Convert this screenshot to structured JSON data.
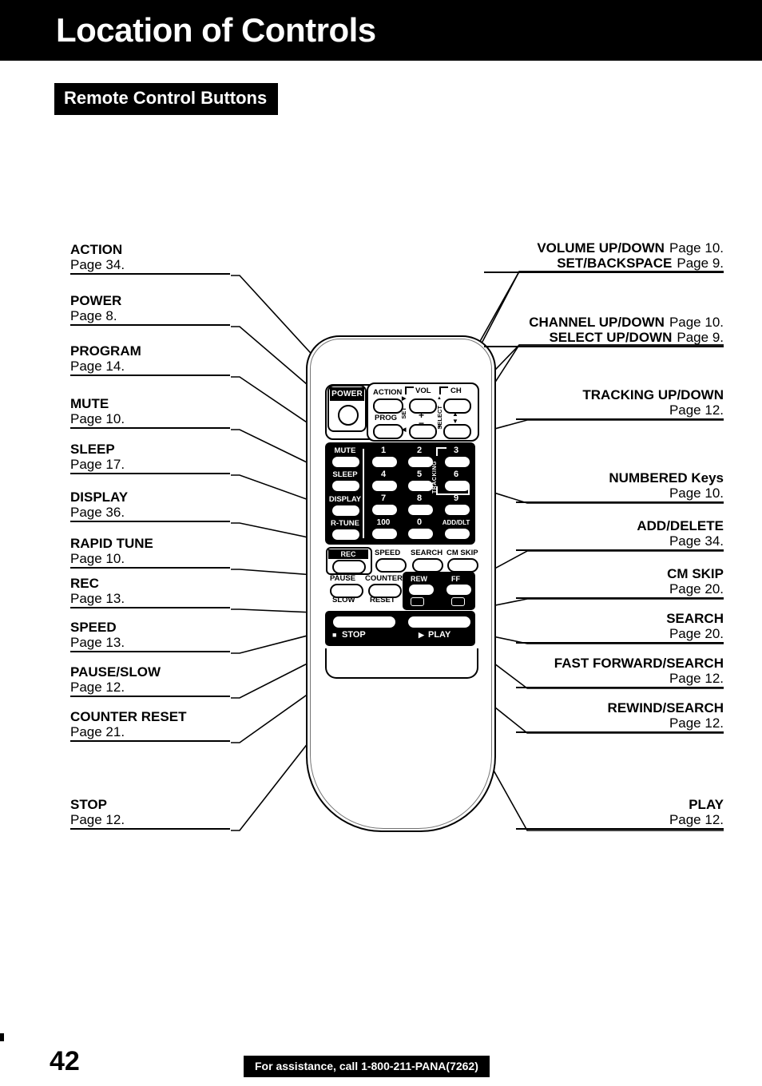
{
  "header": {
    "title": "Location of Controls",
    "section_badge": "Remote Control Buttons"
  },
  "footer": {
    "page_number": "42",
    "assistance": "For assistance, call 1-800-211-PANA(7262)"
  },
  "callouts_left": [
    {
      "title": "ACTION",
      "page": "Page 34."
    },
    {
      "title": "POWER",
      "page": "Page 8."
    },
    {
      "title": "PROGRAM",
      "page": "Page 14."
    },
    {
      "title": "MUTE",
      "page": "Page 10."
    },
    {
      "title": "SLEEP",
      "page": "Page 17."
    },
    {
      "title": "DISPLAY",
      "page": "Page 36."
    },
    {
      "title": "RAPID TUNE",
      "page": "Page 10."
    },
    {
      "title": "REC",
      "page": "Page 13."
    },
    {
      "title": "SPEED",
      "page": "Page 13."
    },
    {
      "title": "PAUSE/SLOW",
      "page": "Page 12."
    },
    {
      "title": "COUNTER RESET",
      "page": "Page 21."
    },
    {
      "title": "STOP",
      "page": "Page 12."
    }
  ],
  "callouts_right": [
    {
      "title": "VOLUME UP/DOWN",
      "page": "Page 10.",
      "inline": true
    },
    {
      "title": "SET/BACKSPACE",
      "page": "Page  9.",
      "inline": true
    },
    {
      "title": "CHANNEL UP/DOWN",
      "page": "Page 10.",
      "inline": true
    },
    {
      "title": "SELECT UP/DOWN",
      "page": "Page  9.",
      "inline": true
    },
    {
      "title": "TRACKING UP/DOWN",
      "page": "Page 12."
    },
    {
      "title": "NUMBERED Keys",
      "page": "Page 10."
    },
    {
      "title": "ADD/DELETE",
      "page": "Page 34."
    },
    {
      "title": "CM SKIP",
      "page": "Page 20."
    },
    {
      "title": "SEARCH",
      "page": "Page 20."
    },
    {
      "title": "FAST FORWARD/SEARCH",
      "page": "Page 12."
    },
    {
      "title": "REWIND/SEARCH",
      "page": "Page 12."
    },
    {
      "title": "PLAY",
      "page": "Page 12."
    }
  ],
  "remote": {
    "power_label": "POWER",
    "action_label": "ACTION",
    "prog_label": "PROG",
    "vol_label": "VOL",
    "ch_label": "CH",
    "set_label": "SET",
    "select_label": "SELECT",
    "vol_plus": "+",
    "vol_minus": "−",
    "ch_up": "▲",
    "ch_down": "▼",
    "set_right": "▶",
    "set_left": "◀",
    "select_up": "▲",
    "select_down": "▼",
    "tracking_label": "TRACKING",
    "side_keys": [
      "MUTE",
      "SLEEP",
      "DISPLAY",
      "R-TUNE"
    ],
    "number_keys": [
      "1",
      "2",
      "3",
      "4",
      "5",
      "6",
      "7",
      "8",
      "9",
      "100",
      "0",
      "ADD/DLT"
    ],
    "rec_label": "REC",
    "speed_label": "SPEED",
    "search_label": "SEARCH",
    "cmskip_label": "CM SKIP",
    "pause_label": "PAUSE",
    "slow_label": "SLOW",
    "counter_label": "COUNTER",
    "reset_label": "RESET",
    "rew_label": "REW",
    "ff_label": "FF",
    "stop_label": "STOP",
    "play_label": "PLAY",
    "stop_glyph": "■",
    "play_glyph": "▶",
    "rew_glyph": "⬅",
    "ff_glyph": "➡"
  },
  "colors": {
    "ink": "#000000",
    "paper": "#ffffff"
  }
}
